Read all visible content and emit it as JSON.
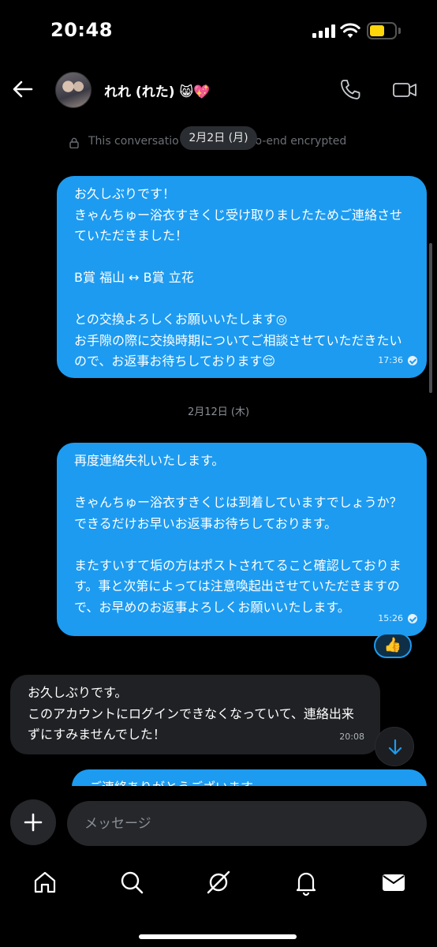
{
  "status_bar": {
    "time": "20:48",
    "battery_color": "#ffd60a"
  },
  "header": {
    "contact_name": "れれ (れた) 😸💖",
    "icons": [
      "back-arrow-icon",
      "phone-icon",
      "video-camera-icon"
    ]
  },
  "conversation": {
    "encryption_notice": "This conversatio",
    "encryption_notice_tail": "to-end encrypted",
    "date_pill": "2月2日 (月)",
    "messages": [
      {
        "direction": "outgoing",
        "text": "お久しぶりです！\nきゃんちゅー浴衣すきくじ受け取りましたためご連絡させていただきました！\n\nB賞 福山 ↔ B賞 立花\n\nとの交換よろしくお願いいたします◎\nお手隙の際に交換時期についてご相談させていただきたいので、お返事お待ちしております😌",
        "time": "17:36"
      },
      {
        "direction": "outgoing",
        "text": "再度連絡失礼いたします。\n\nきゃんちゅー浴衣すきくじは到着していますでしょうか？できるだけお早いお返事お待ちしております。\n\nまたすいすて垢の方はポストされてること確認しております。事と次第によっては注意喚起出させていただきますので、お早めのお返事よろしくお願いいたします。",
        "time": "15:26",
        "reaction": "👍"
      },
      {
        "direction": "incoming",
        "text": "お久しぶりです。\nこのアカウントにログインできなくなっていて、連絡出来ずにすみませんでした！",
        "time": "20:08"
      },
      {
        "direction": "outgoing",
        "text": "ご連絡ありがとうございます。",
        "time": ""
      }
    ],
    "date_separator_2": "2月12日 (木)"
  },
  "composer": {
    "placeholder": "メッセージ"
  },
  "bottom_nav": [
    "home-icon",
    "search-icon",
    "grok-icon",
    "notifications-bell-icon",
    "messages-envelope-icon"
  ],
  "colors": {
    "accent": "#1d9bf0",
    "incoming_bubble": "#1f2124",
    "background": "#000000"
  }
}
